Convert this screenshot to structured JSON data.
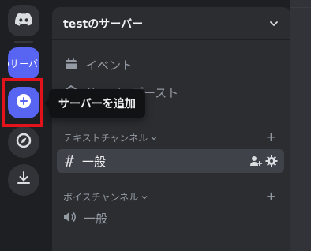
{
  "rail": {
    "server_label": "のサーバ"
  },
  "server": {
    "name": "testのサーバー"
  },
  "menu": {
    "events": "イベント",
    "boost": "サーバーブースト"
  },
  "categories": {
    "text": "テキストチャンネル",
    "voice": "ボイスチャンネル"
  },
  "channels": {
    "text": [
      {
        "name": "一般",
        "selected": true
      }
    ],
    "voice": [
      {
        "name": "一般"
      }
    ]
  },
  "tooltip": {
    "text": "サーバーを追加"
  },
  "colors": {
    "blurple": "#5865f2",
    "highlight_red": "#e3131b",
    "rail_bg": "#1e1f22",
    "panel_bg": "#2b2d31",
    "selected_bg": "#404249"
  },
  "icons": [
    "discord-logo",
    "plus-circle",
    "compass",
    "download",
    "calendar",
    "boost",
    "hash",
    "speaker",
    "invite",
    "gear",
    "chevron-down"
  ]
}
